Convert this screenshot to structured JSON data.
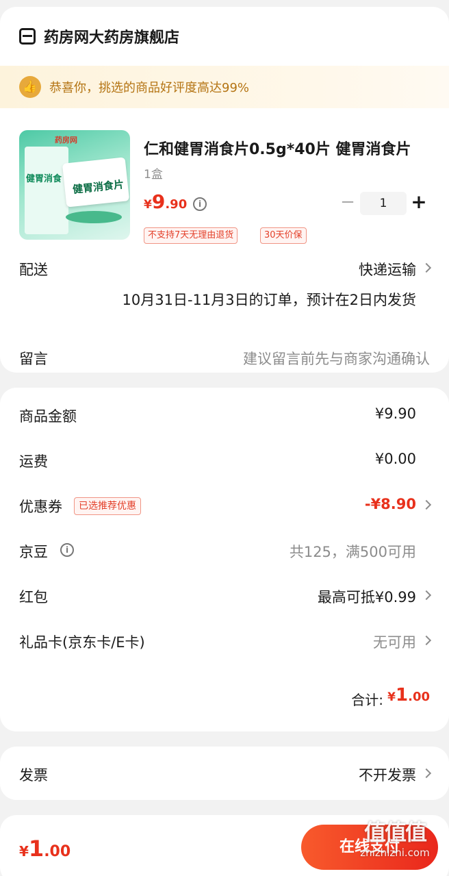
{
  "store": {
    "name": "药房网大药房旗舰店",
    "icon": "store-icon"
  },
  "praise_banner": {
    "icon": "thumbs-up-icon",
    "text": "恭喜你，挑选的商品好评度高达99%"
  },
  "product": {
    "title": "仁和健胃消食片0.5g*40片 健胃消食片",
    "spec": "1盒",
    "price": {
      "currency": "¥",
      "int": "9",
      "dec": ".90"
    },
    "quantity": "1",
    "tags": [
      "不支持7天无理由退货",
      "30天价保"
    ],
    "image_text": {
      "brand": "药房网",
      "box_title": "健胃消食",
      "card_title": "健胃消食片"
    }
  },
  "delivery": {
    "label": "配送",
    "method": "快递运输",
    "note": "10月31日-11月3日的订单，预计在2日内发货"
  },
  "message": {
    "label": "留言",
    "placeholder": "建议留言前先与商家沟通确认"
  },
  "amounts": {
    "goods": {
      "label": "商品金额",
      "value": "¥9.90"
    },
    "shipping": {
      "label": "运费",
      "value": "¥0.00"
    },
    "coupon": {
      "label": "优惠券",
      "tag": "已选推荐优惠",
      "value": "-¥8.90"
    },
    "jingdou": {
      "label": "京豆",
      "value": "共125，满500可用"
    },
    "red_packet": {
      "label": "红包",
      "value": "最高可抵¥0.99"
    },
    "gift_card": {
      "label": "礼品卡(京东卡/E卡)",
      "value": "无可用"
    },
    "total": {
      "label": "合计:",
      "currency": "¥",
      "int": "1",
      "dec": ".00"
    }
  },
  "invoice": {
    "label": "发票",
    "value": "不开发票"
  },
  "bottom": {
    "currency": "¥",
    "int": "1",
    "dec": ".00",
    "pay_button": "在线支付"
  },
  "watermark": {
    "logo": "值值值",
    "url": "zhizhizhi.com"
  },
  "colors": {
    "accent": "#e8311c",
    "praise_text": "#b47413",
    "praise_icon": "#e7a93b"
  }
}
